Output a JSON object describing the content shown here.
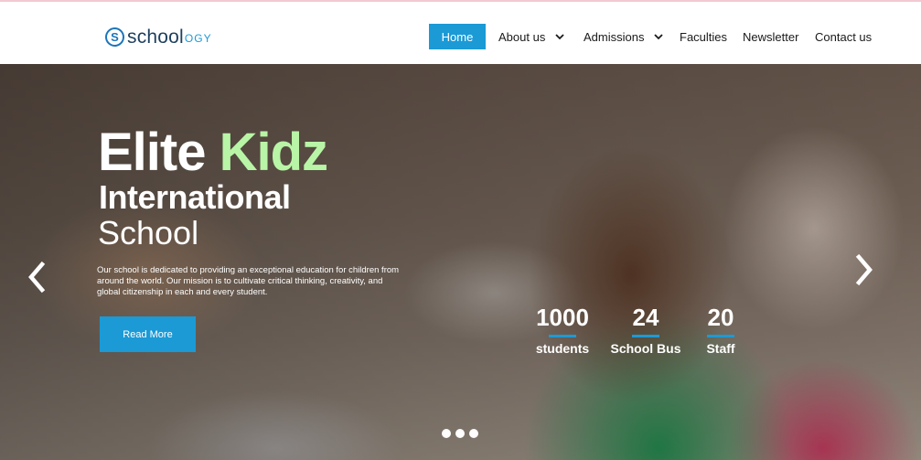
{
  "brand": {
    "name": "school",
    "suffix": "OGY",
    "letter": "S"
  },
  "nav": {
    "home": "Home",
    "about": "About us",
    "admissions": "Admissions",
    "faculties": "Faculties",
    "newsletter": "Newsletter",
    "contact": "Contact us"
  },
  "hero": {
    "title_part1": "Elite ",
    "title_part2": "Kidz",
    "title_line2": "International",
    "title_line3": "School",
    "description": "Our school is dedicated to providing an exceptional education for children from around the world. Our mission is to cultivate critical thinking, creativity, and global citizenship in each and every student.",
    "cta": "Read More"
  },
  "stats": [
    {
      "value": "1000",
      "label": "students"
    },
    {
      "value": "24",
      "label": "School Bus"
    },
    {
      "value": "20",
      "label": "Staff"
    }
  ],
  "carousel": {
    "slides": 3
  },
  "colors": {
    "accent": "#1b9ad6",
    "highlight": "#b9f5a6",
    "brand_dark": "#1d3f5e"
  },
  "icons": [
    "chevron-down-icon",
    "arrow-left-icon",
    "arrow-right-icon",
    "logo-s-icon"
  ]
}
